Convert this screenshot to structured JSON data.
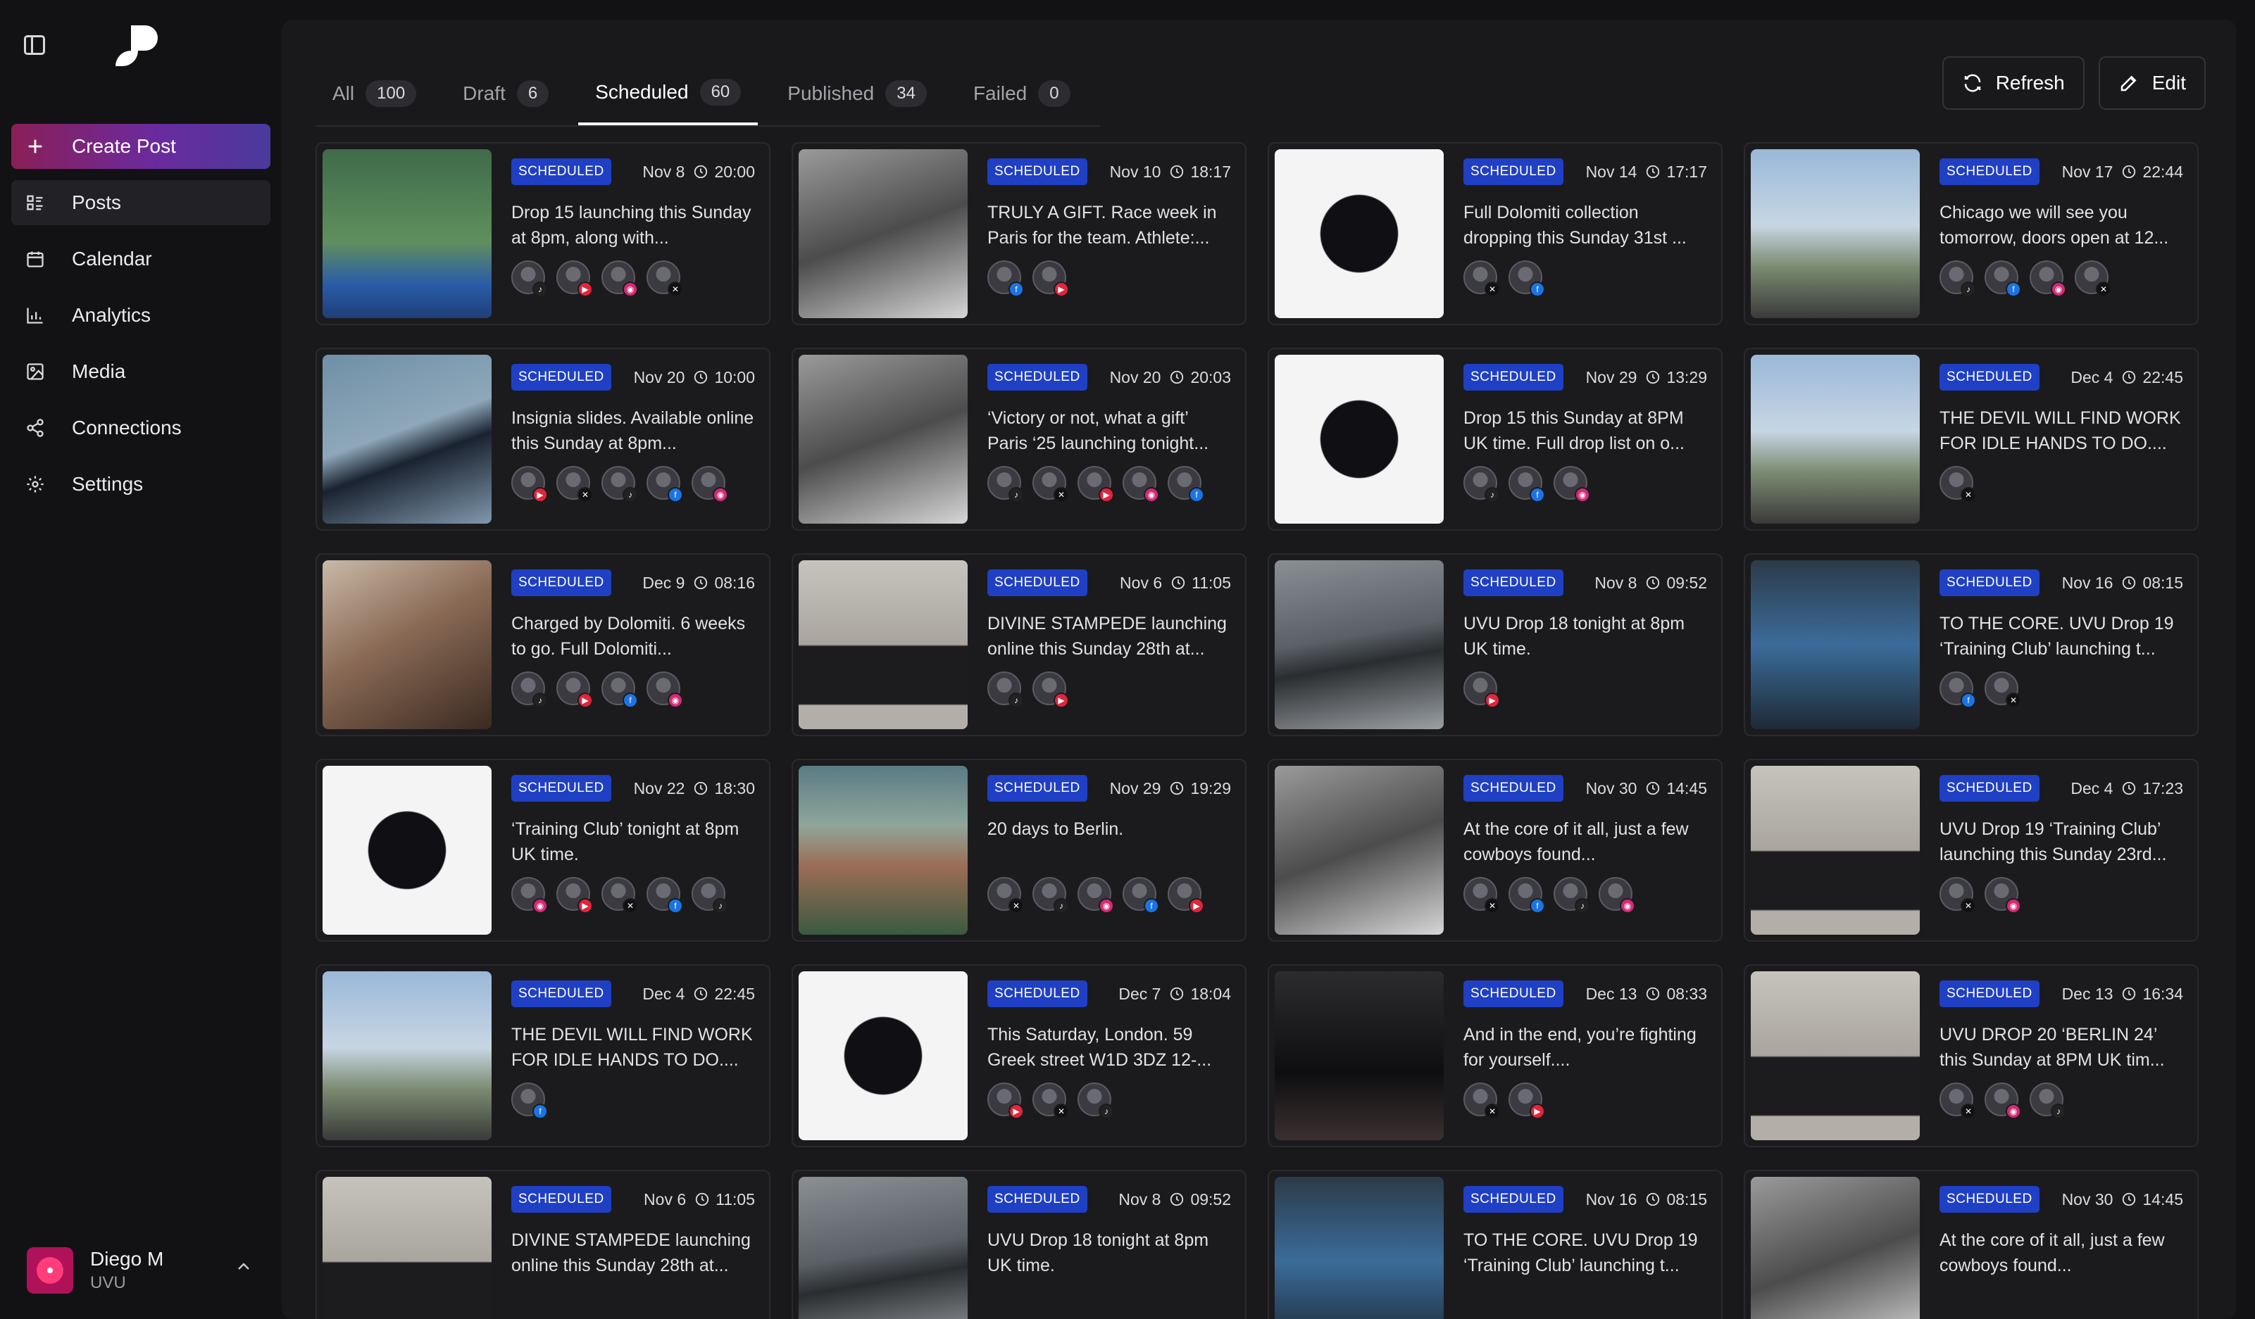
{
  "sidebar": {
    "items": [
      {
        "label": "Create Post",
        "icon": "plus-icon"
      },
      {
        "label": "Posts",
        "icon": "posts-icon"
      },
      {
        "label": "Calendar",
        "icon": "calendar-icon"
      },
      {
        "label": "Analytics",
        "icon": "analytics-icon"
      },
      {
        "label": "Media",
        "icon": "media-icon"
      },
      {
        "label": "Connections",
        "icon": "connections-icon"
      },
      {
        "label": "Settings",
        "icon": "gear-icon"
      }
    ],
    "user": {
      "name": "Diego M",
      "org": "UVU"
    }
  },
  "tabs": [
    {
      "label": "All",
      "count": "100"
    },
    {
      "label": "Draft",
      "count": "6"
    },
    {
      "label": "Scheduled",
      "count": "60"
    },
    {
      "label": "Published",
      "count": "34"
    },
    {
      "label": "Failed",
      "count": "0"
    }
  ],
  "actions": {
    "refresh": "Refresh",
    "edit": "Edit"
  },
  "colors": {
    "accent": "#1f3fc4",
    "create_gradient": [
      "#8a1f56",
      "#4a3a9c"
    ],
    "background": "#121214"
  },
  "posts": [
    {
      "status": "SCHEDULED",
      "date": "Nov 8",
      "time": "20:00",
      "caption": "Drop 15 launching this Sunday at 8pm, along with...",
      "networks": [
        "tt",
        "yt",
        "ig",
        "x"
      ],
      "thumb": "green"
    },
    {
      "status": "SCHEDULED",
      "date": "Nov 10",
      "time": "18:17",
      "caption": "TRULY A GIFT. Race week in Paris for the team. Athlete:...",
      "networks": [
        "fb",
        "yt"
      ],
      "thumb": "bw"
    },
    {
      "status": "SCHEDULED",
      "date": "Nov 14",
      "time": "17:17",
      "caption": "Full Dolomiti collection dropping this Sunday 31st ...",
      "networks": [
        "x",
        "fb"
      ],
      "thumb": "white"
    },
    {
      "status": "SCHEDULED",
      "date": "Nov 17",
      "time": "22:44",
      "caption": "Chicago we will see you tomorrow, doors open at 12...",
      "networks": [
        "tt",
        "fb",
        "ig",
        "x"
      ],
      "thumb": "sky"
    },
    {
      "status": "SCHEDULED",
      "date": "Nov 20",
      "time": "10:00",
      "caption": "Insignia slides. Available online this Sunday at 8pm...",
      "networks": [
        "yt",
        "x",
        "tt",
        "fb",
        "ig"
      ],
      "thumb": "blue"
    },
    {
      "status": "SCHEDULED",
      "date": "Nov 20",
      "time": "20:03",
      "caption": "‘Victory or not, what a gift’ Paris ‘25 launching tonight...",
      "networks": [
        "tt",
        "x",
        "yt",
        "ig",
        "fb"
      ],
      "thumb": "bw"
    },
    {
      "status": "SCHEDULED",
      "date": "Nov 29",
      "time": "13:29",
      "caption": "Drop 15 this Sunday at 8PM UK time. Full drop list on o...",
      "networks": [
        "tt",
        "fb",
        "ig"
      ],
      "thumb": "white"
    },
    {
      "status": "SCHEDULED",
      "date": "Dec 4",
      "time": "22:45",
      "caption": "THE DEVIL WILL FIND WORK FOR IDLE HANDS TO DO....",
      "networks": [
        "x"
      ],
      "thumb": "sky"
    },
    {
      "status": "SCHEDULED",
      "date": "Dec 9",
      "time": "08:16",
      "caption": "Charged by Dolomiti. 6 weeks to go. Full Dolomiti...",
      "networks": [
        "tt",
        "yt",
        "fb",
        "ig"
      ],
      "thumb": "warm"
    },
    {
      "status": "SCHEDULED",
      "date": "Nov 6",
      "time": "11:05",
      "caption": "DIVINE STAMPEDE launching online this Sunday 28th at...",
      "networks": [
        "tt",
        "yt"
      ],
      "thumb": "grey"
    },
    {
      "status": "SCHEDULED",
      "date": "Nov 8",
      "time": "09:52",
      "caption": "UVU Drop 18 tonight at 8pm UK time.",
      "networks": [
        "yt"
      ],
      "thumb": "street"
    },
    {
      "status": "SCHEDULED",
      "date": "Nov 16",
      "time": "08:15",
      "caption": "TO THE CORE. UVU Drop 19 ‘Training Club’ launching t...",
      "networks": [
        "fb",
        "x"
      ],
      "thumb": "gym"
    },
    {
      "status": "SCHEDULED",
      "date": "Nov 22",
      "time": "18:30",
      "caption": "‘Training Club’ tonight at 8pm UK time.",
      "networks": [
        "ig",
        "yt",
        "x",
        "fb",
        "tt"
      ],
      "thumb": "white"
    },
    {
      "status": "SCHEDULED",
      "date": "Nov 29",
      "time": "19:29",
      "caption": "20 days to Berlin.",
      "networks": [
        "x",
        "tt",
        "ig",
        "fb",
        "yt"
      ],
      "thumb": "mountain"
    },
    {
      "status": "SCHEDULED",
      "date": "Nov 30",
      "time": "14:45",
      "caption": "At the core of it all, just a few cowboys found...",
      "networks": [
        "x",
        "fb",
        "tt",
        "ig"
      ],
      "thumb": "bw"
    },
    {
      "status": "SCHEDULED",
      "date": "Dec 4",
      "time": "17:23",
      "caption": "UVU Drop 19 ‘Training Club’ launching this Sunday 23rd...",
      "networks": [
        "x",
        "ig"
      ],
      "thumb": "grey"
    },
    {
      "status": "SCHEDULED",
      "date": "Dec 4",
      "time": "22:45",
      "caption": "THE DEVIL WILL FIND WORK FOR IDLE HANDS TO DO....",
      "networks": [
        "fb"
      ],
      "thumb": "sky"
    },
    {
      "status": "SCHEDULED",
      "date": "Dec 7",
      "time": "18:04",
      "caption": "This Saturday, London. 59 Greek street W1D 3DZ 12-...",
      "networks": [
        "yt",
        "x",
        "tt"
      ],
      "thumb": "white"
    },
    {
      "status": "SCHEDULED",
      "date": "Dec 13",
      "time": "08:33",
      "caption": "And in the end, you’re fighting for yourself....",
      "networks": [
        "x",
        "yt"
      ],
      "thumb": "dark"
    },
    {
      "status": "SCHEDULED",
      "date": "Dec 13",
      "time": "16:34",
      "caption": "UVU DROP 20 ‘BERLIN 24’ this Sunday at 8PM UK tim...",
      "networks": [
        "x",
        "ig",
        "tt"
      ],
      "thumb": "grey"
    },
    {
      "status": "SCHEDULED",
      "date": "Nov 6",
      "time": "11:05",
      "caption": "DIVINE STAMPEDE launching online this Sunday 28th at...",
      "networks": [],
      "thumb": "grey"
    },
    {
      "status": "SCHEDULED",
      "date": "Nov 8",
      "time": "09:52",
      "caption": "UVU Drop 18 tonight at 8pm UK time.",
      "networks": [],
      "thumb": "street"
    },
    {
      "status": "SCHEDULED",
      "date": "Nov 16",
      "time": "08:15",
      "caption": "TO THE CORE. UVU Drop 19 ‘Training Club’ launching t...",
      "networks": [],
      "thumb": "gym"
    },
    {
      "status": "SCHEDULED",
      "date": "Nov 30",
      "time": "14:45",
      "caption": "At the core of it all, just a few cowboys found...",
      "networks": [],
      "thumb": "bw"
    }
  ]
}
